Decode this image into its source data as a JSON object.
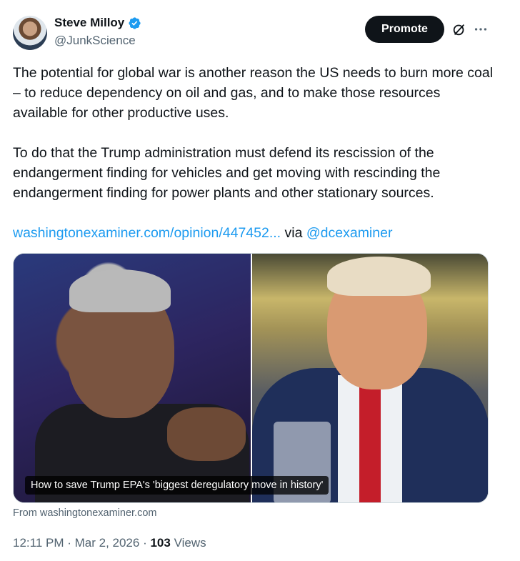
{
  "author": {
    "display_name": "Steve Milloy",
    "handle": "@JunkScience"
  },
  "header": {
    "promote_label": "Promote"
  },
  "tweet": {
    "paragraph1": "The potential for global war is another reason the US needs to burn more coal – to reduce dependency on oil and gas, and to make those resources available for other productive uses.",
    "paragraph2": "To do that the Trump administration must defend its rescission of the endangerment finding for vehicles and get moving with rescinding the endangerment finding for power plants and other stationary sources.",
    "link_text": "washingtonexaminer.com/opinion/447452...",
    "via_text": " via ",
    "via_handle": "@dcexaminer"
  },
  "card": {
    "caption": "How to save Trump EPA's 'biggest deregulatory move in history'",
    "source": "From washingtonexaminer.com"
  },
  "meta": {
    "time": "12:11 PM",
    "separator1": " · ",
    "date": "Mar 2, 2026",
    "separator2": " · ",
    "views_count": "103",
    "views_label": " Views"
  },
  "icons": {
    "verified": "verified-badge-icon",
    "grok": "grok-icon",
    "more": "more-icon"
  },
  "colors": {
    "link": "#1d9bf0",
    "verified": "#1d9bf0",
    "promote_bg": "#0f1419"
  }
}
